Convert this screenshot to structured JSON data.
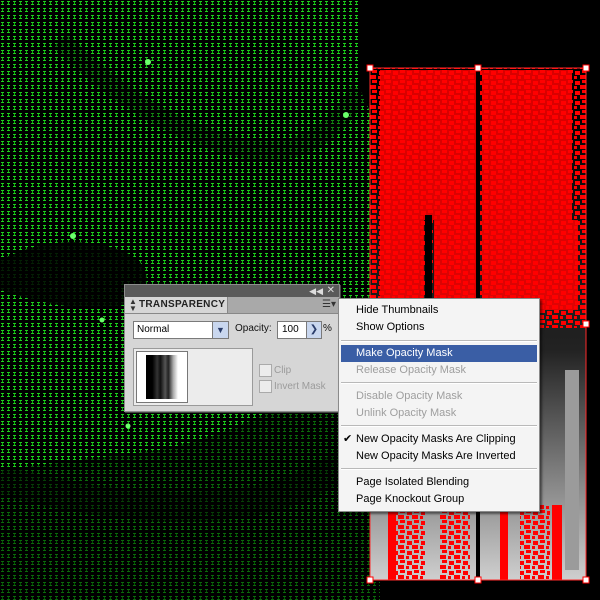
{
  "panel": {
    "tab_title": "TRANSPARENCY",
    "tab_arrows_icon": "up-down-arrows-icon",
    "collapse_icon": "double-chevron-left-icon",
    "close_icon": "close-icon",
    "menu_icon": "panel-menu-icon",
    "blend_mode": "Normal",
    "opacity_label": "Opacity:",
    "opacity_value": "100",
    "opacity_unit": "%",
    "clip_label": "Clip",
    "invert_mask_label": "Invert Mask"
  },
  "menu": {
    "items": [
      {
        "label": "Hide Thumbnails",
        "state": "enabled"
      },
      {
        "label": "Show Options",
        "state": "enabled"
      },
      {
        "label": "Make Opacity Mask",
        "state": "highlight"
      },
      {
        "label": "Release Opacity Mask",
        "state": "disabled"
      },
      {
        "label": "Disable Opacity Mask",
        "state": "disabled"
      },
      {
        "label": "Unlink Opacity Mask",
        "state": "disabled"
      },
      {
        "label": "New Opacity Masks Are Clipping",
        "state": "enabled",
        "checked": true
      },
      {
        "label": "New Opacity Masks Are Inverted",
        "state": "enabled"
      },
      {
        "label": "Page Isolated Blending",
        "state": "enabled"
      },
      {
        "label": "Page Knockout Group",
        "state": "enabled"
      }
    ]
  },
  "colors": {
    "matrix_green": "#1dd11d",
    "selection_red": "#ff0000",
    "menu_highlight": "#3a5ea5"
  }
}
